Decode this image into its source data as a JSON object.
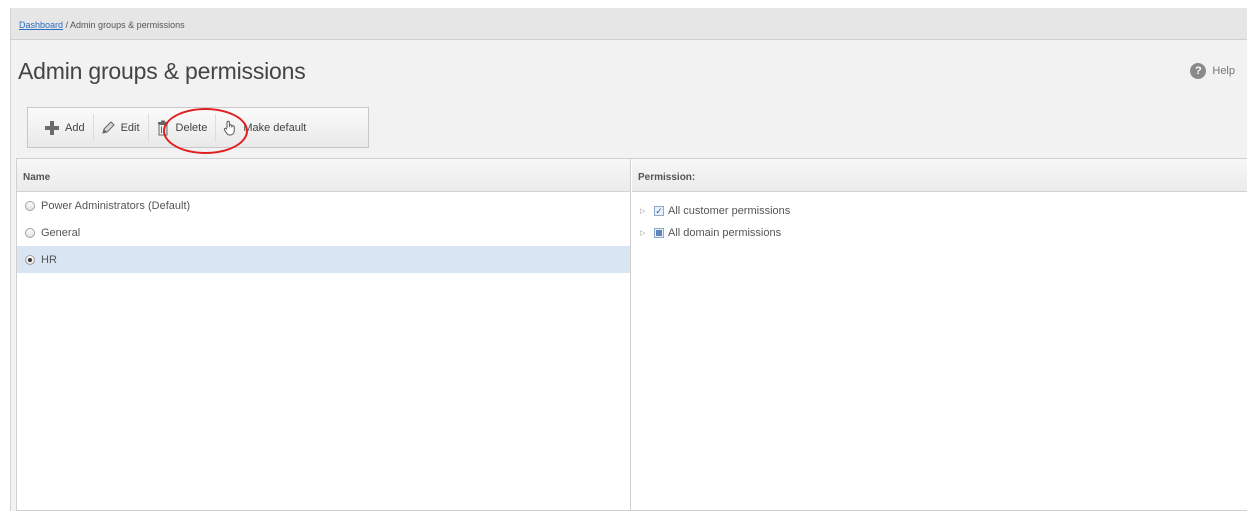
{
  "breadcrumb": {
    "link": "Dashboard",
    "separator": " / ",
    "current": "Admin groups & permissions"
  },
  "page": {
    "title": "Admin groups & permissions",
    "help_label": "Help",
    "help_glyph": "?"
  },
  "toolbar": {
    "add_label": "Add",
    "edit_label": "Edit",
    "delete_label": "Delete",
    "make_default_label": "Make default"
  },
  "groups": {
    "header": "Name",
    "items": [
      {
        "label": "Power Administrators (Default)",
        "selected": false
      },
      {
        "label": "General",
        "selected": false
      },
      {
        "label": "HR",
        "selected": true
      }
    ]
  },
  "permissions": {
    "header": "Permission:",
    "items": [
      {
        "label": "All customer permissions",
        "state": "checked"
      },
      {
        "label": "All domain permissions",
        "state": "partial"
      }
    ]
  },
  "colors": {
    "highlight_ring": "#e02020",
    "selected_row": "#d9e5f3",
    "link": "#2a6fc1"
  }
}
